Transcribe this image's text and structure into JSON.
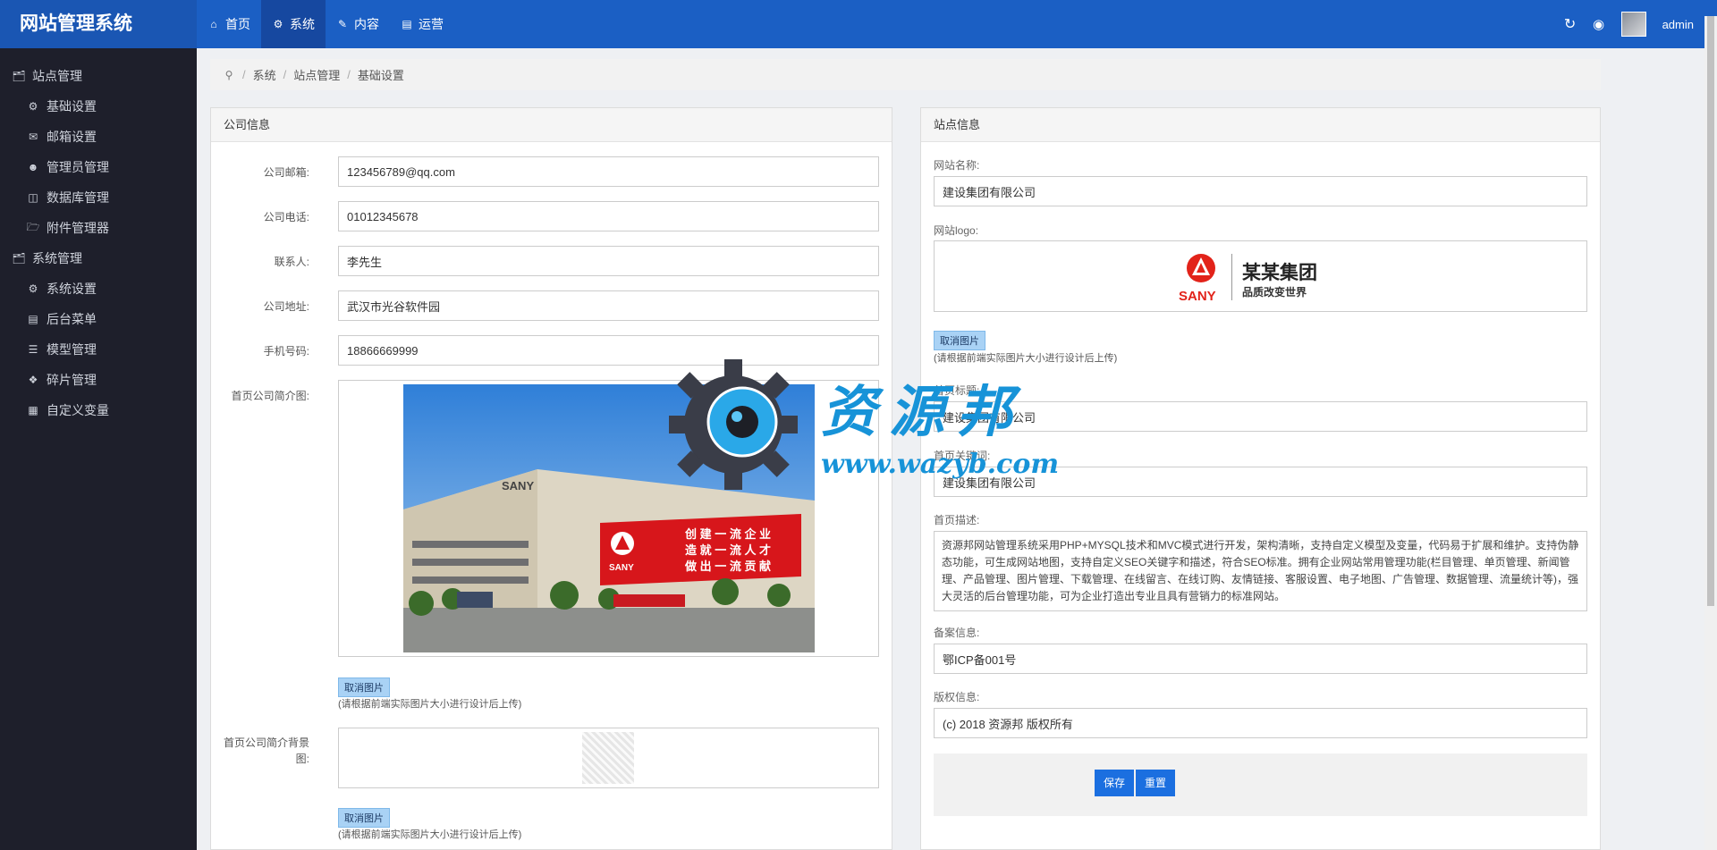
{
  "app": {
    "title": "网站管理系统"
  },
  "topnav": [
    {
      "label": "首页",
      "icon": "home-icon"
    },
    {
      "label": "系统",
      "icon": "gears-icon"
    },
    {
      "label": "内容",
      "icon": "edit-icon"
    },
    {
      "label": "运营",
      "icon": "bar-chart-icon"
    }
  ],
  "user": {
    "name": "admin"
  },
  "sidebar": {
    "groups": [
      {
        "label": "站点管理",
        "items": [
          "基础设置",
          "邮箱设置",
          "管理员管理",
          "数据库管理",
          "附件管理器"
        ]
      },
      {
        "label": "系统管理",
        "items": [
          "系统设置",
          "后台菜单",
          "模型管理",
          "碎片管理",
          "自定义变量"
        ]
      }
    ]
  },
  "breadcrumb": [
    "系统",
    "站点管理",
    "基础设置"
  ],
  "company": {
    "title": "公司信息",
    "fields": [
      {
        "label": "公司邮箱:",
        "value": "123456789@qq.com"
      },
      {
        "label": "公司电话:",
        "value": "01012345678"
      },
      {
        "label": "联系人:",
        "value": "李先生"
      },
      {
        "label": "公司地址:",
        "value": "武汉市光谷软件园"
      },
      {
        "label": "手机号码:",
        "value": "18866669999"
      }
    ],
    "intro_image_label": "首页公司简介图:",
    "intro_bg_label": "首页公司简介背景图:",
    "cancel_image": "取消图片",
    "upload_hint": "(请根据前端实际图片大小进行设计后上传)",
    "photo": {
      "building_sign": "SANY",
      "banner_brand": "SANY",
      "banner_lines": [
        "创 建 一 流 企 业",
        "造 就 一 流 人 才",
        "做 出 一 流 贡 献"
      ]
    }
  },
  "site": {
    "title": "站点信息",
    "name_label": "网站名称:",
    "name_value": "建设集团有限公司",
    "logo_label": "网站logo:",
    "logo": {
      "brand": "SANY",
      "name": "某某集团",
      "slogan": "品质改变世界"
    },
    "cancel_image": "取消图片",
    "upload_hint": "(请根据前端实际图片大小进行设计后上传)",
    "seo_title_label": "首页标题:",
    "seo_title_value": "建设集团有限公司",
    "keywords_label": "首页关键词:",
    "keywords_value": "建设集团有限公司",
    "desc_label": "首页描述:",
    "desc_value": "资源邦网站管理系统采用PHP+MYSQL技术和MVC模式进行开发，架构清晰，支持自定义模型及变量，代码易于扩展和维护。支持伪静态功能，可生成网站地图，支持自定义SEO关键字和描述，符合SEO标准。拥有企业网站常用管理功能(栏目管理、单页管理、新闻管理、产品管理、图片管理、下载管理、在线留言、在线订购、友情链接、客服设置、电子地图、广告管理、数据管理、流量统计等)，强大灵活的后台管理功能，可为企业打造出专业且具有营销力的标准网站。",
    "icp_label": "备案信息:",
    "icp_value": "鄂ICP备001号",
    "copyright_label": "版权信息:",
    "copyright_value": "(c) 2018 资源邦 版权所有",
    "save_label": "保存",
    "reset_label": "重置"
  },
  "watermark": {
    "text": "资源邦",
    "url": "www.wazyb.com"
  },
  "colors": {
    "topbar": "#1b5fc4",
    "sidebar": "#1e1f2b",
    "primary_button": "#1b6fe0"
  }
}
